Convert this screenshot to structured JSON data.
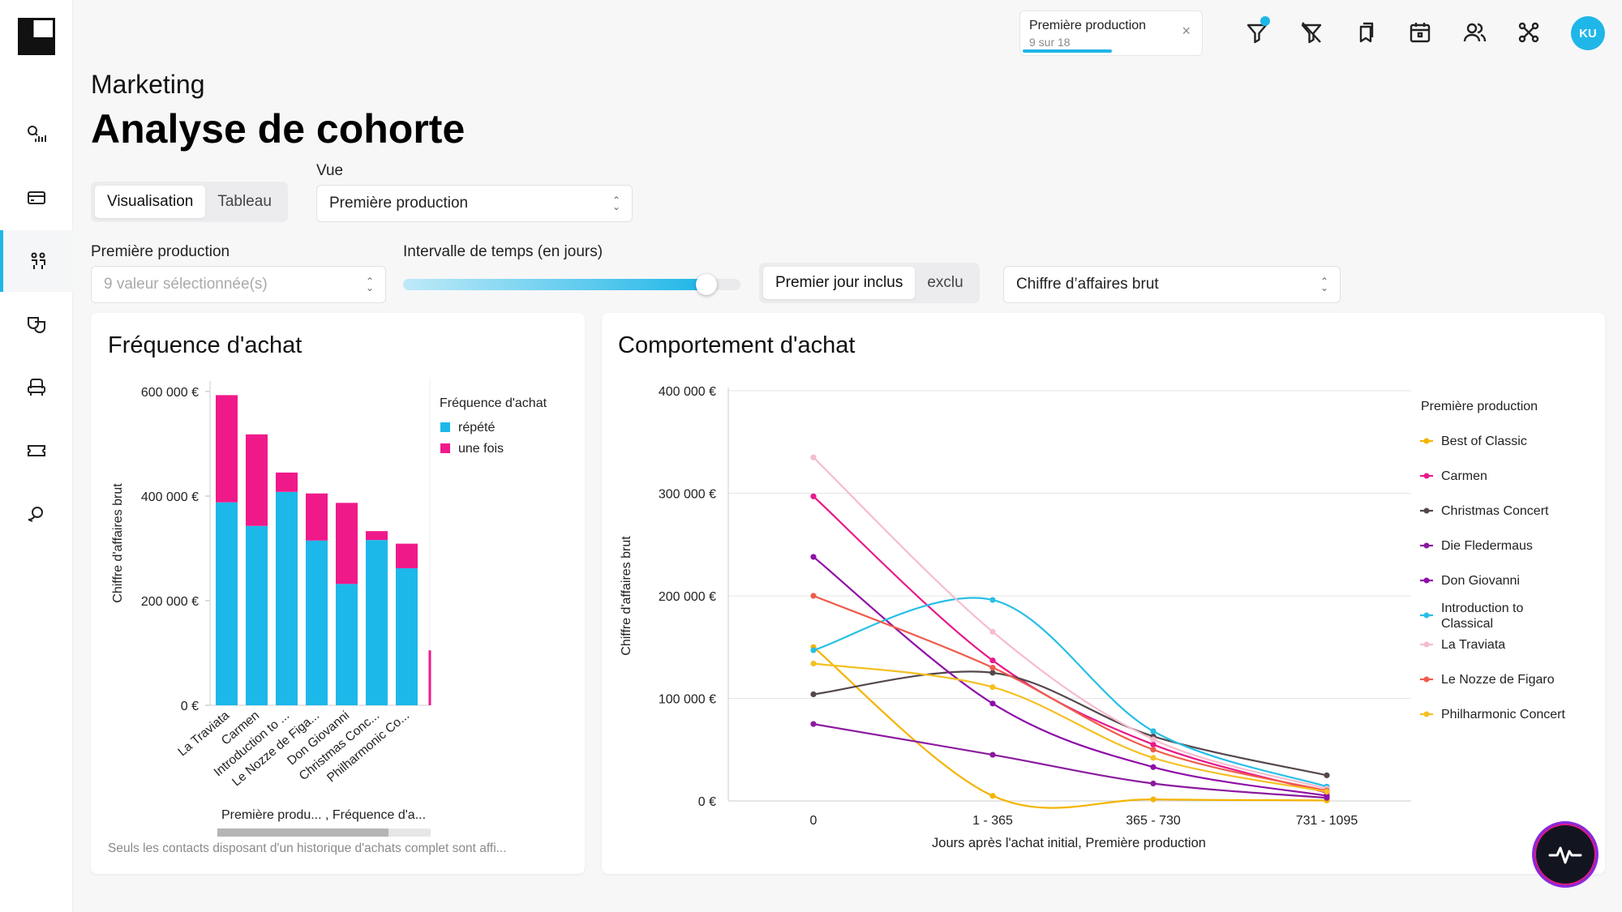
{
  "filter_chip": {
    "title": "Première production",
    "subtitle": "9 sur 18",
    "close_glyph": "×"
  },
  "user": {
    "initials": "KU"
  },
  "header": {
    "kicker": "Marketing",
    "title": "Analyse de cohorte"
  },
  "view_toggle": {
    "options": [
      "Visualisation",
      "Tableau"
    ],
    "selected": "Visualisation"
  },
  "vue": {
    "label": "Vue",
    "value": "Première production"
  },
  "production_filter": {
    "label": "Première production",
    "placeholder": "9 valeur sélectionnée(s)"
  },
  "interval": {
    "label": "Intervalle de temps (en jours)",
    "level": 0.9
  },
  "first_day_toggle": {
    "options": [
      "Premier jour inclus",
      "exclu"
    ],
    "selected": "Premier jour inclus"
  },
  "metric_select": {
    "value": "Chiffre d’affaires brut"
  },
  "colors": {
    "accent": "#1fb6e8",
    "repeat": "#1cb8ea",
    "once": "#f0198a"
  },
  "freq_card": {
    "title": "Fréquence d'achat",
    "scroll_label": "Première produ... , Fréquence d'a...",
    "footnote": "Seuls les contacts disposant d'un historique d'achats complet sont affi..."
  },
  "behav_card": {
    "title": "Comportement d'achat"
  },
  "chart_data": [
    {
      "type": "bar",
      "stacked": true,
      "title": "Fréquence d'achat",
      "xlabel": "",
      "ylabel": "Chiffre d'affaires brut",
      "ylim": [
        0,
        620000
      ],
      "yticks": [
        0,
        200000,
        400000,
        600000
      ],
      "ytick_labels": [
        "0 €",
        "200 000 €",
        "400 000 €",
        "600 000 €"
      ],
      "legend_title": "Fréquence d'achat",
      "legend_position": "right",
      "categories": [
        "La Traviata",
        "Carmen",
        "Introduction to ...",
        "Le Nozze de Figa...",
        "Don Giovanni",
        "Christmas Conc...",
        "Philharmonic Co..."
      ],
      "series": [
        {
          "name": "répété",
          "color": "#1cb8ea",
          "values": [
            388000,
            343000,
            408000,
            315000,
            232000,
            316000,
            262000
          ]
        },
        {
          "name": "une fois",
          "color": "#f0198a",
          "values": [
            205000,
            175000,
            37000,
            90000,
            155000,
            17000,
            47000
          ]
        }
      ]
    },
    {
      "type": "line",
      "title": "Comportement d'achat",
      "xlabel": "Jours après l'achat initial, Première production",
      "ylabel": "Chiffre d'affaires brut",
      "categories": [
        "0",
        "1 - 365",
        "365 - 730",
        "731 - 1095"
      ],
      "ylim": [
        0,
        400000
      ],
      "yticks": [
        0,
        100000,
        200000,
        300000,
        400000
      ],
      "ytick_labels": [
        "0 €",
        "100 000 €",
        "200 000 €",
        "300 000 €",
        "400 000 €"
      ],
      "legend_title": "Première production",
      "legend_position": "right",
      "series": [
        {
          "name": "Best of Classic",
          "color": "#f4b400",
          "values": [
            150000,
            5000,
            1500,
            500
          ]
        },
        {
          "name": "Carmen",
          "color": "#e8198b",
          "values": [
            297000,
            137000,
            55000,
            8000
          ]
        },
        {
          "name": "Christmas Concert",
          "color": "#55474c",
          "values": [
            104000,
            125000,
            63000,
            25000
          ]
        },
        {
          "name": "Die Fledermaus",
          "color": "#8b1a9e",
          "values": [
            75000,
            45000,
            17000,
            3000
          ]
        },
        {
          "name": "Don Giovanni",
          "color": "#8e0ea8",
          "values": [
            238000,
            95000,
            33000,
            5000
          ]
        },
        {
          "name": "Introduction to Classical",
          "color": "#27bfe6",
          "values": [
            147000,
            196000,
            68000,
            14000
          ]
        },
        {
          "name": "La Traviata",
          "color": "#f6bcd0",
          "values": [
            335000,
            165000,
            60000,
            12000
          ]
        },
        {
          "name": "Le Nozze de Figaro",
          "color": "#ef5b4b",
          "values": [
            200000,
            130000,
            50000,
            10000
          ]
        },
        {
          "name": "Philharmonic Concert",
          "color": "#f4c023",
          "values": [
            134000,
            111000,
            42000,
            9000
          ]
        }
      ]
    }
  ]
}
